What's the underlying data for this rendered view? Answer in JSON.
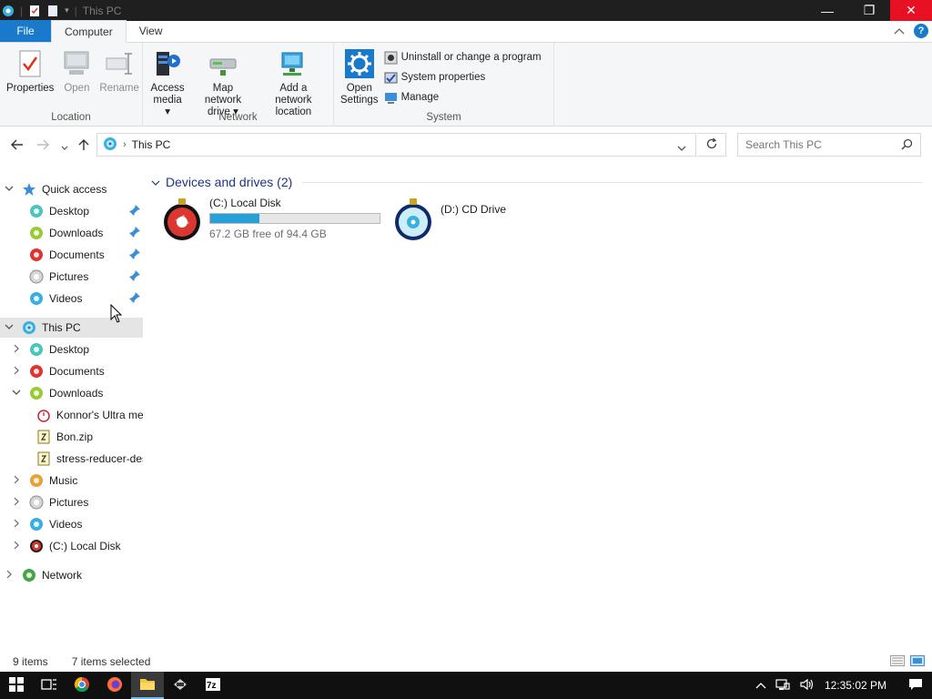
{
  "window": {
    "title": "This PC",
    "controls": {
      "minimize": "—",
      "maximize": "❐",
      "close": "✕"
    }
  },
  "ribbon": {
    "tabs": [
      {
        "label": "File"
      },
      {
        "label": "Computer"
      },
      {
        "label": "View"
      }
    ],
    "groups": {
      "location": {
        "label": "Location",
        "buttons": {
          "properties": "Properties",
          "open": "Open",
          "rename": "Rename"
        }
      },
      "network": {
        "label": "Network",
        "buttons": {
          "access_media_1": "Access",
          "access_media_2": "media ▾",
          "map_drive_1": "Map network",
          "map_drive_2": "drive ▾",
          "add_location_1": "Add a network",
          "add_location_2": "location"
        }
      },
      "system": {
        "label": "System",
        "open_settings_1": "Open",
        "open_settings_2": "Settings",
        "uninstall": "Uninstall or change a program",
        "system_properties": "System properties",
        "manage": "Manage"
      }
    }
  },
  "address": {
    "path": "This PC",
    "search_placeholder": "Search This PC"
  },
  "nav": {
    "quick_access": "Quick access",
    "quick_items": [
      "Desktop",
      "Downloads",
      "Documents",
      "Pictures",
      "Videos"
    ],
    "this_pc": "This PC",
    "pc_items": [
      "Desktop",
      "Documents",
      "Downloads"
    ],
    "downloads_children": [
      "Konnor's Ultra me",
      "Bon.zip",
      "stress-reducer-des"
    ],
    "pc_items_2": [
      "Music",
      "Pictures",
      "Videos",
      "(C:) Local Disk"
    ],
    "network": "Network"
  },
  "content": {
    "group_title": "Devices and drives (2)",
    "drives": [
      {
        "name": "(C:) Local Disk",
        "free": "67.2 GB free of 94.4 GB",
        "used_fraction": 0.288
      },
      {
        "name": "(D:) CD Drive"
      }
    ]
  },
  "status": {
    "items": "9 items",
    "selected": "7 items selected"
  },
  "taskbar": {
    "time": "12:35:02 PM"
  },
  "colors": {
    "accent": "#1979ca",
    "progress": "#26a0da",
    "group_title": "#1e3287"
  }
}
